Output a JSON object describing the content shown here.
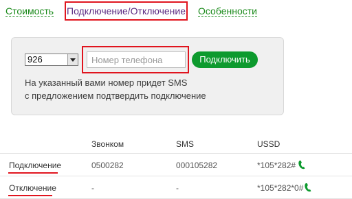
{
  "tabs": [
    {
      "label": "Стоимость"
    },
    {
      "label": "Подключение/Отключение",
      "active": true
    },
    {
      "label": "Особенности"
    }
  ],
  "form": {
    "code_value": "926",
    "phone_placeholder": "Номер телефона",
    "connect_label": "Подключить",
    "note_line1": "На указанный вами номер придет SMS",
    "note_line2": "с предложением подтвердить подключение"
  },
  "table": {
    "headers": [
      "",
      "Звонком",
      "SMS",
      "USSD"
    ],
    "rows": [
      {
        "action": "Подключение",
        "call": "0500282",
        "sms": "000105282",
        "ussd": "*105*282#"
      },
      {
        "action": "Отключение",
        "call": "-",
        "sms": "-",
        "ussd": "*105*282*0#"
      }
    ]
  },
  "colors": {
    "accent_green": "#0d9a2e",
    "highlight_red": "#e0141e",
    "active_tab": "#5b2a82"
  },
  "icons": {
    "ussd_dial": "phone-handset-icon"
  }
}
